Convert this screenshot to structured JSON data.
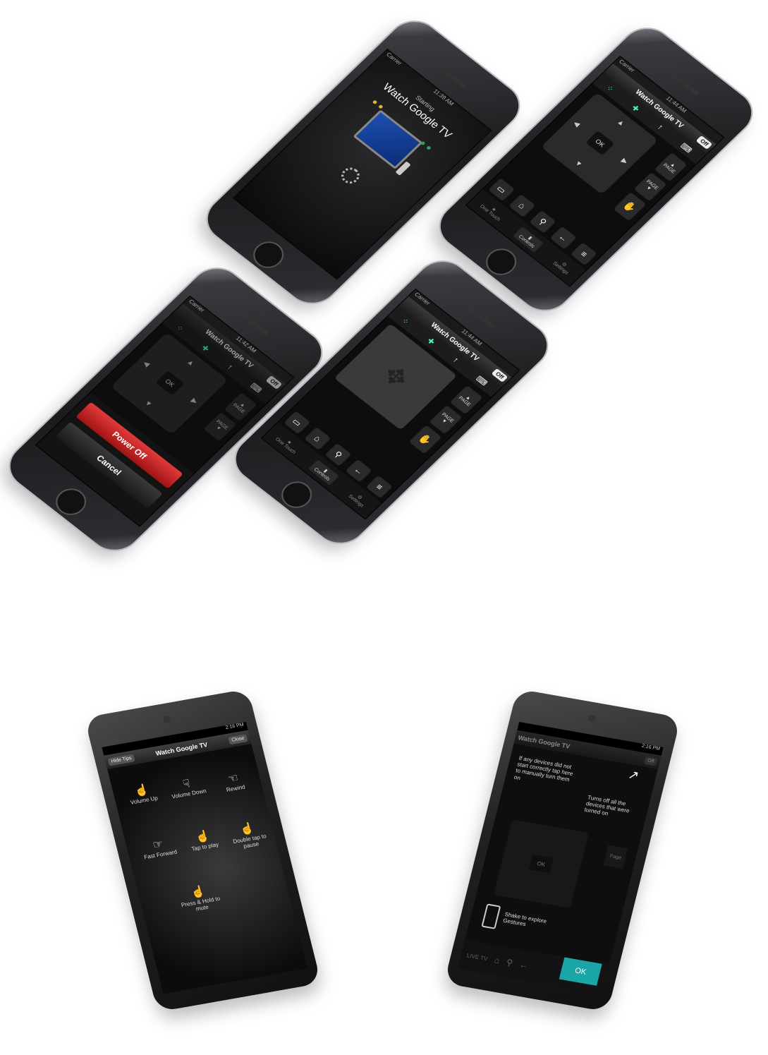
{
  "phone1": {
    "status": {
      "carrier": "Carrier",
      "time": "11:39 AM"
    },
    "subtitle": "Starting",
    "title": "Watch Google TV"
  },
  "phone2": {
    "status": {
      "carrier": "Carrier",
      "time": "11:44 AM"
    },
    "title": "Watch Google TV",
    "off": "Off",
    "ok": "OK",
    "page": "PAGE",
    "tabs": [
      "One Touch",
      "Controls",
      "Settings"
    ]
  },
  "phone3": {
    "status": {
      "carrier": "Carrier",
      "time": "11:42 AM"
    },
    "title": "Watch Google TV",
    "off": "Off",
    "ok": "OK",
    "page": "PAGE",
    "power_off": "Power Off",
    "cancel": "Cancel"
  },
  "phone4": {
    "status": {
      "carrier": "Carrier",
      "time": "11:44 AM"
    },
    "title": "Watch Google TV",
    "off": "Off",
    "page": "PAGE",
    "tabs": [
      "One Touch",
      "Controls",
      "Settings"
    ]
  },
  "android1": {
    "time": "2:16 PM",
    "hide_tips": "Hide Tips",
    "title": "Watch Google TV",
    "close": "Close",
    "gestures": [
      "Volume Up",
      "Volume Down",
      "Rewind",
      "Fast Forward",
      "Tap to play",
      "Double tap to pause",
      "Press & Hold to mute"
    ]
  },
  "android2": {
    "time": "2:16 PM",
    "title": "Watch Google TV",
    "off": "Off",
    "tip_left": "If any devices did not start correctly tap here to manually turn them on",
    "tip_right": "Turns off all the devices that were turned on",
    "page": "Page",
    "ok_small": "OK",
    "shake": "Shake to explore Gestures",
    "live_tv": "LIVE TV",
    "ok": "OK"
  }
}
